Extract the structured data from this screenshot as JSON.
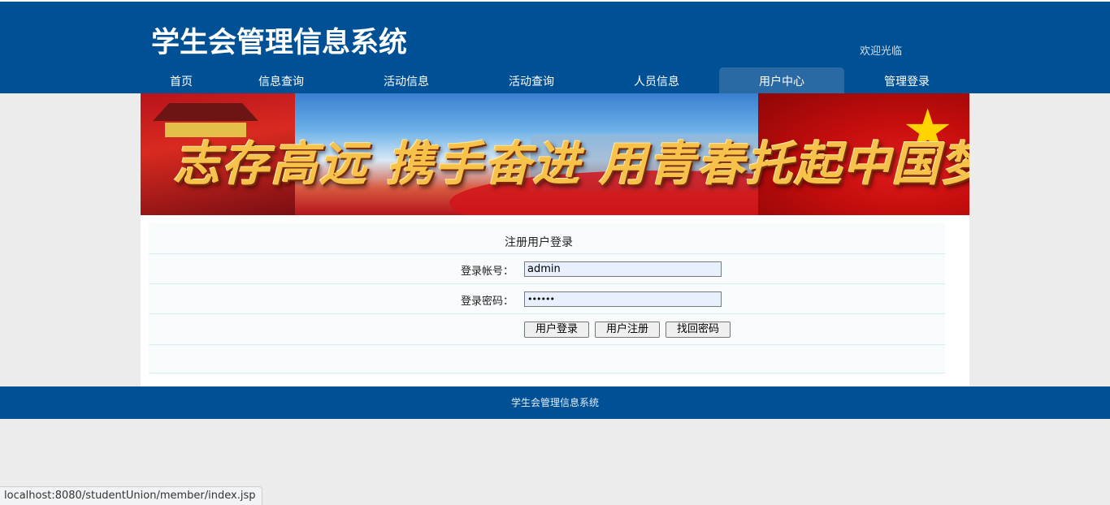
{
  "header": {
    "site_title": "学生会管理信息系统",
    "welcome": "欢迎光临",
    "background_color": "#005096"
  },
  "nav": {
    "items": [
      {
        "label": "首页"
      },
      {
        "label": "信息查询"
      },
      {
        "label": "活动信息"
      },
      {
        "label": "活动查询"
      },
      {
        "label": "人员信息"
      },
      {
        "label": "用户中心",
        "active": true
      },
      {
        "label": "管理登录"
      }
    ]
  },
  "banner": {
    "slogan": "志存高远 携手奋进 用青春托起中国梦"
  },
  "login_form": {
    "title": "注册用户登录",
    "account_label": "登录帐号：",
    "account_value": "admin",
    "password_label": "登录密码：",
    "password_value": "••••••",
    "login_button": "用户登录",
    "register_button": "用户注册",
    "recover_button": "找回密码"
  },
  "footer": {
    "text": "学生会管理信息系统"
  },
  "statusbar": {
    "url": "localhost:8080/studentUnion/member/index.jsp"
  }
}
